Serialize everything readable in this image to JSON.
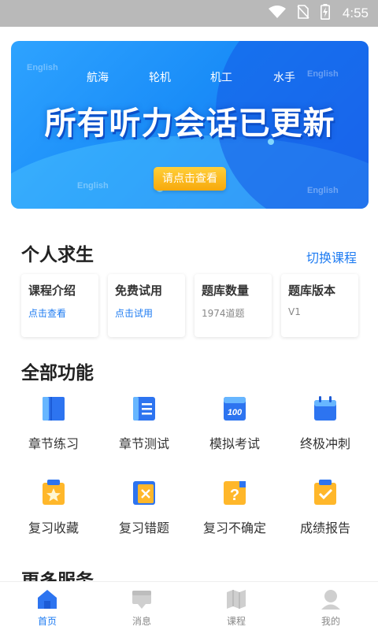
{
  "status_bar": {
    "time": "4:55",
    "icons": [
      "wifi-icon",
      "no-sim-icon",
      "battery-charging-icon"
    ]
  },
  "banner": {
    "categories": [
      "航海",
      "轮机",
      "机工",
      "水手"
    ],
    "ghost_text": [
      "English",
      "English",
      "English",
      "English"
    ],
    "headline": "所有听力会话已更新",
    "cta_label": "请点击查看"
  },
  "course": {
    "title": "个人求生",
    "switch_label": "切换课程",
    "cards": [
      {
        "title": "课程介绍",
        "sub": "点击查看",
        "kind": "link"
      },
      {
        "title": "免费试用",
        "sub": "点击试用",
        "kind": "link"
      },
      {
        "title": "题库数量",
        "sub": "1974道题",
        "kind": "plain"
      },
      {
        "title": "题库版本",
        "sub": "V1",
        "kind": "plain"
      }
    ]
  },
  "functions": {
    "title": "全部功能",
    "items": [
      {
        "label": "章节练习",
        "icon": "book-icon"
      },
      {
        "label": "章节测试",
        "icon": "list-icon"
      },
      {
        "label": "模拟考试",
        "icon": "score-100-icon"
      },
      {
        "label": "终极冲刺",
        "icon": "calendar-icon"
      },
      {
        "label": "复习收藏",
        "icon": "star-clipboard-icon"
      },
      {
        "label": "复习错题",
        "icon": "wrong-book-icon"
      },
      {
        "label": "复习不确定",
        "icon": "question-icon"
      },
      {
        "label": "成绩报告",
        "icon": "check-clipboard-icon"
      }
    ]
  },
  "more_services": {
    "title": "更多服务"
  },
  "bottom_nav": {
    "items": [
      {
        "label": "首页",
        "icon": "home-icon",
        "active": true
      },
      {
        "label": "消息",
        "icon": "message-icon",
        "active": false
      },
      {
        "label": "课程",
        "icon": "map-icon",
        "active": false
      },
      {
        "label": "我的",
        "icon": "user-icon",
        "active": false
      }
    ]
  },
  "colors": {
    "accent": "#1f7cf2",
    "banner_start": "#2ea3ff",
    "banner_end": "#1f6df0",
    "cta": "#f7a90c",
    "status_bar": "#b9b9b9"
  }
}
